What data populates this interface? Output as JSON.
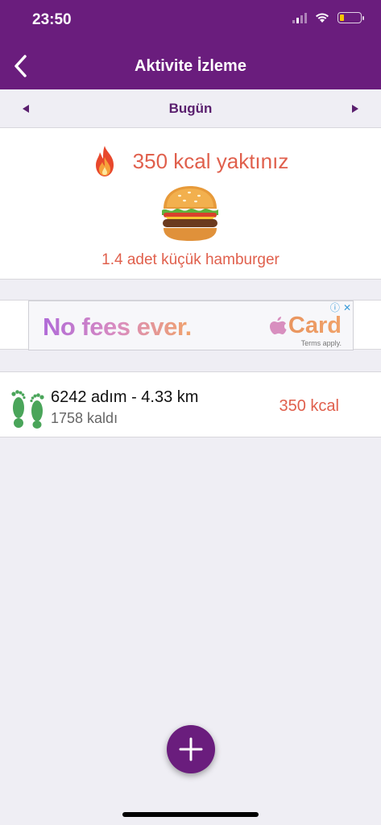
{
  "status_bar": {
    "time": "23:50"
  },
  "header": {
    "title": "Aktivite İzleme"
  },
  "date_nav": {
    "label": "Bugün"
  },
  "calorie_card": {
    "burned_text": "350 kcal yaktınız",
    "food_equivalent": "1.4 adet küçük hamburger"
  },
  "ad": {
    "headline": "No fees ever.",
    "brand": "Card",
    "terms": "Terms apply."
  },
  "steps": {
    "summary": "6242 adım - 4.33 km",
    "remaining": "1758 kaldı",
    "kcal": "350 kcal"
  },
  "colors": {
    "primary": "#6a1d7d",
    "accent": "#e0604d",
    "feet_green": "#4aa55a",
    "date_label": "#5a1f6e"
  },
  "icons": {
    "back": "chevron-left-icon",
    "prev": "triangle-left-icon",
    "next": "triangle-right-icon",
    "fire": "fire-icon",
    "burger": "hamburger-icon",
    "feet": "footprints-icon",
    "add": "plus-icon"
  }
}
